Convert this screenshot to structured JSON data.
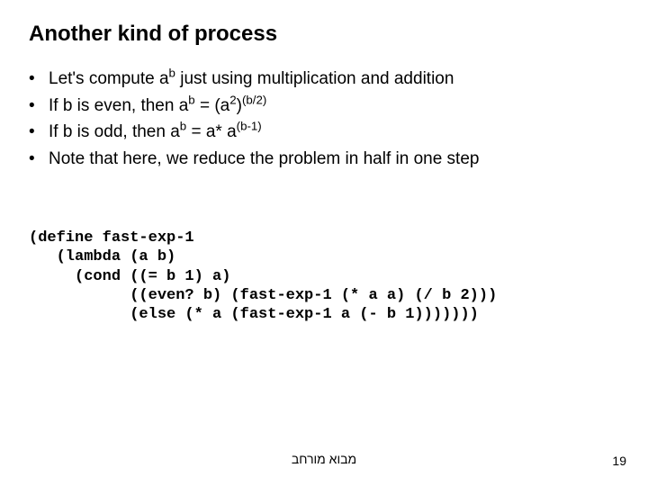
{
  "title": "Another kind of process",
  "bullets": {
    "dot": "•",
    "b1a": "Let's compute a",
    "b1b": " just using multiplication and addition",
    "b1_sup": "b",
    "b2a": "If b is even, then  a",
    "b2b": " =  (a",
    "b2c": ")",
    "b2_sup1": "b",
    "b2_sup2": "2",
    "b2_sup3": "(b/2)",
    "b3a": "If b is odd, then a",
    "b3b": " = a* a",
    "b3_sup1": "b",
    "b3_sup2": "(b-1)",
    "b4": "Note that here, we reduce the problem in half in one step"
  },
  "code": "(define fast-exp-1\n   (lambda (a b)\n     (cond ((= b 1) a)\n           ((even? b) (fast-exp-1 (* a a) (/ b 2)))\n           (else (* a (fast-exp-1 a (- b 1)))))))",
  "footer_center": "מבוא מורחב",
  "page_number": "19"
}
